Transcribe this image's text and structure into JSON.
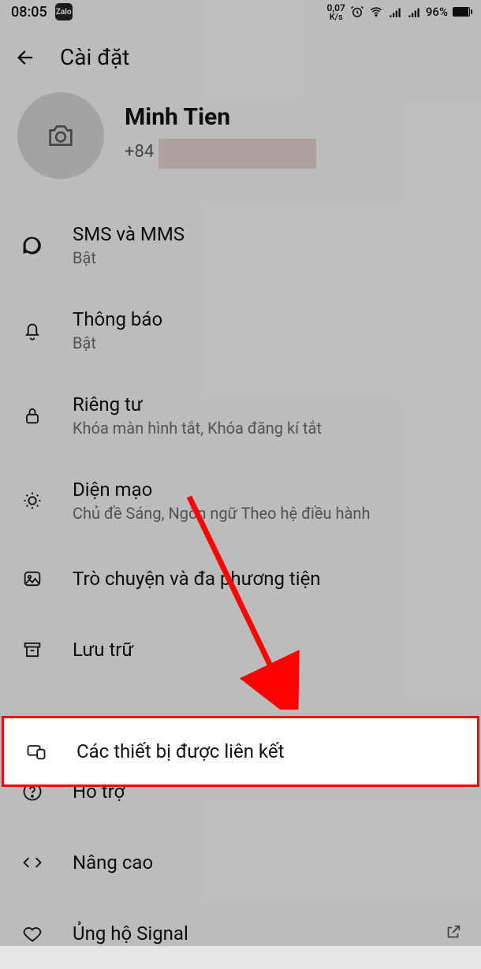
{
  "status": {
    "time": "08:05",
    "app_badge": "Zalo",
    "net_speed_value": "0,07",
    "net_speed_unit": "K/s",
    "battery_pct": "96%"
  },
  "header": {
    "title": "Cài đặt"
  },
  "profile": {
    "name": "Minh Tien",
    "phone_prefix": "+84"
  },
  "items": {
    "sms": {
      "title": "SMS và MMS",
      "sub": "Bật"
    },
    "notify": {
      "title": "Thông báo",
      "sub": "Bật"
    },
    "privacy": {
      "title": "Riêng tư",
      "sub": "Khóa màn hình tắt, Khóa đăng kí tắt"
    },
    "appear": {
      "title": "Diện mạo",
      "sub": "Chủ đề Sáng, Ngôn ngữ Theo hệ điều hành"
    },
    "chat": {
      "title": "Trò chuyện và đa phương tiện"
    },
    "storage": {
      "title": "Lưu trữ"
    },
    "linked": {
      "title": "Các thiết bị được liên kết"
    },
    "help": {
      "title": "Hỗ trợ"
    },
    "advanced": {
      "title": "Nâng cao"
    },
    "donate": {
      "title": "Ủng hộ Signal"
    }
  }
}
